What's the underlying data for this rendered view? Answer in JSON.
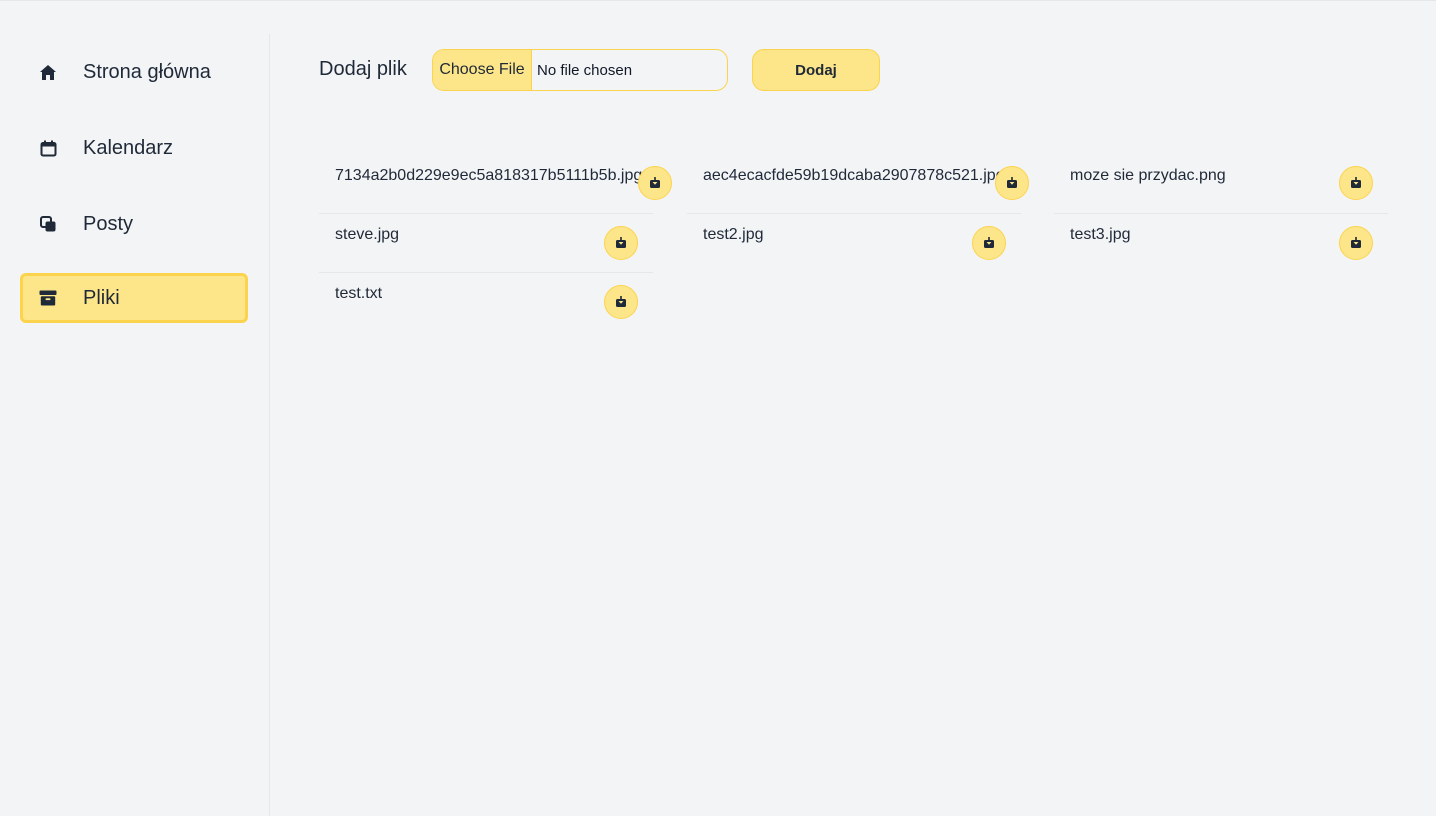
{
  "sidebar": {
    "items": [
      {
        "label": "Strona główna",
        "icon": "home-icon",
        "active": false
      },
      {
        "label": "Kalendarz",
        "icon": "calendar-icon",
        "active": false
      },
      {
        "label": "Posty",
        "icon": "copy-icon",
        "active": false
      },
      {
        "label": "Pliki",
        "icon": "archive-icon",
        "active": true
      }
    ]
  },
  "upload": {
    "label": "Dodaj plik",
    "choose_label": "Choose File",
    "status": "No file chosen",
    "submit_label": "Dodaj"
  },
  "files": [
    {
      "name": "7134a2b0d229e9ec5a818317b5111b5b.jpg"
    },
    {
      "name": "aec4ecacfde59b19dcaba2907878c521.jpg"
    },
    {
      "name": "moze sie przydac.png"
    },
    {
      "name": "steve.jpg"
    },
    {
      "name": "test2.jpg"
    },
    {
      "name": "test3.jpg"
    },
    {
      "name": "test.txt"
    }
  ],
  "colors": {
    "accent": "#fde68a",
    "accent_border": "#fcd34d",
    "background": "#f3f4f6",
    "text": "#1f2937"
  }
}
